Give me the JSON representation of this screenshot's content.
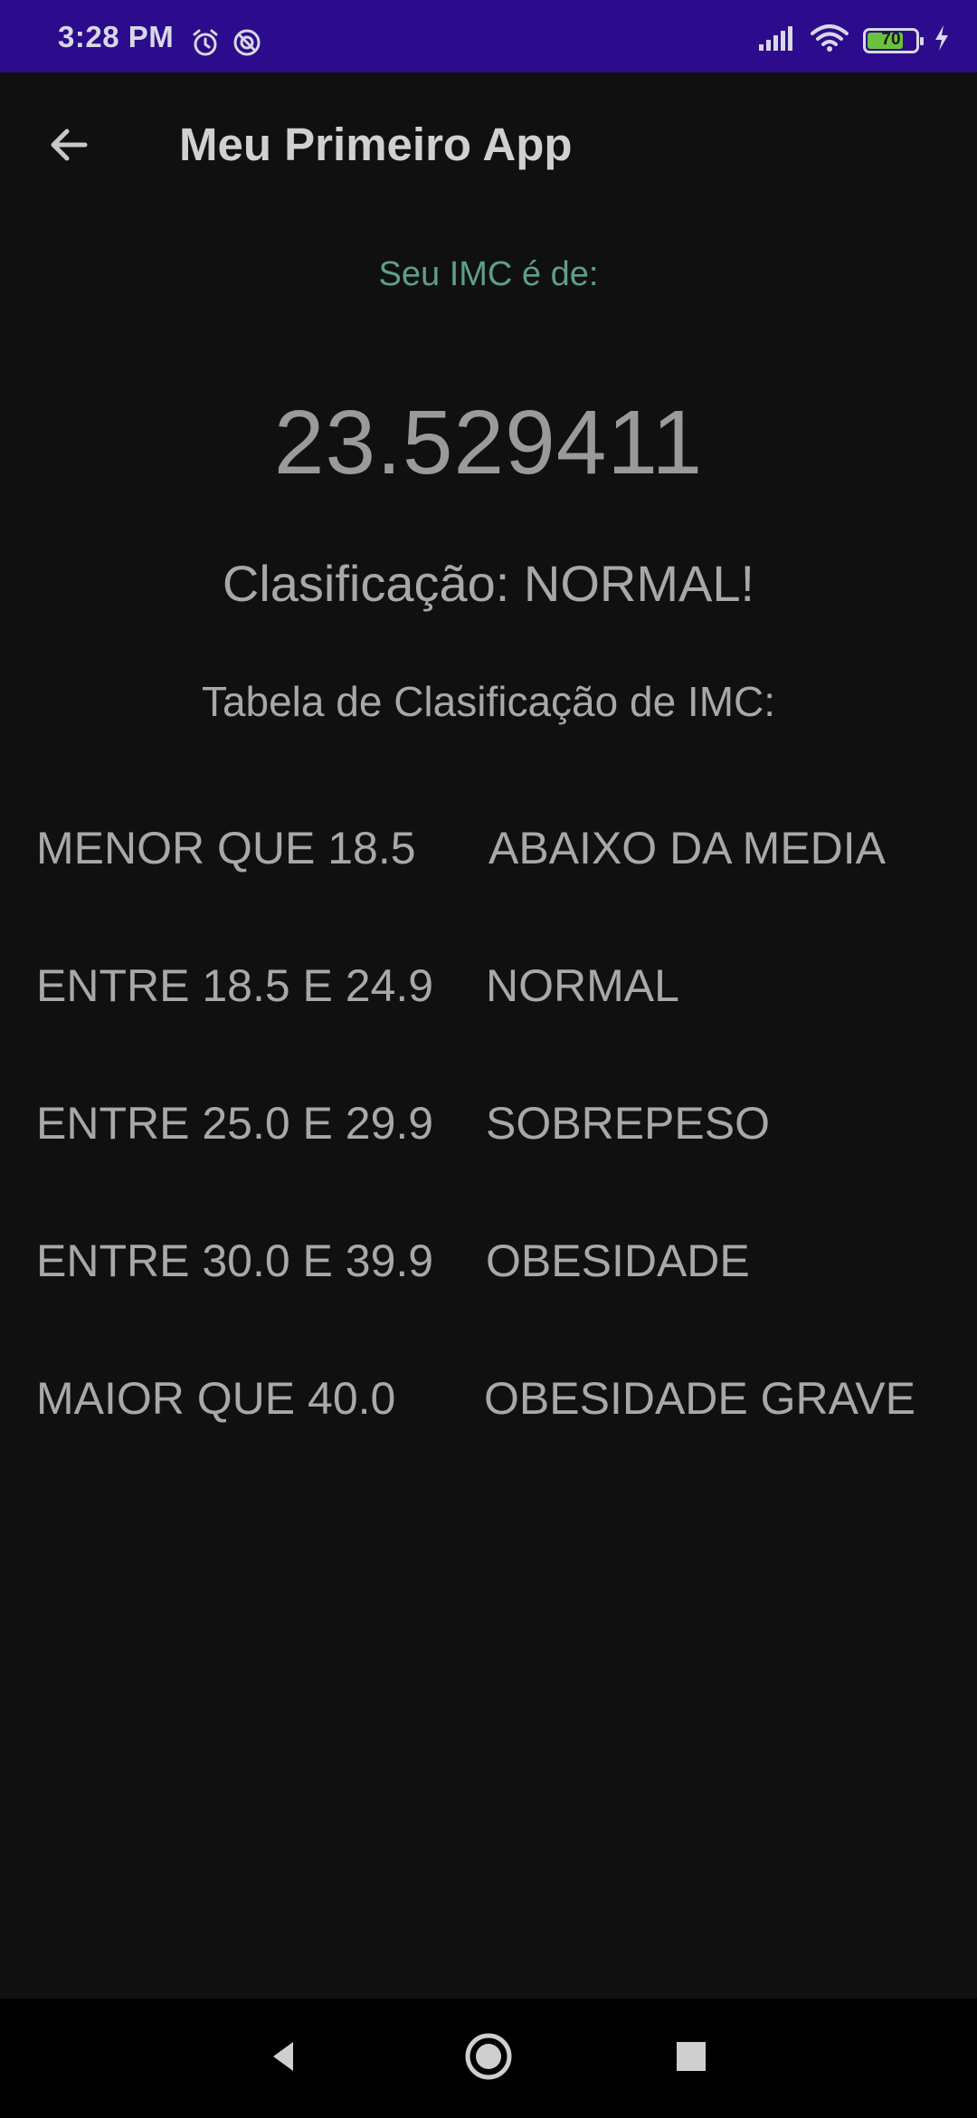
{
  "status_bar": {
    "time": "3:28 PM",
    "battery_level": "70",
    "icons": [
      "alarm-icon",
      "do-not-disturb-icon",
      "signal-icon",
      "wifi-icon",
      "battery-icon",
      "charging-icon"
    ]
  },
  "app_bar": {
    "title": "Meu Primeiro App",
    "back_icon": "arrow-left-icon"
  },
  "result": {
    "label": "Seu IMC é de:",
    "value": "23.529411",
    "classification": "Clasificação: NORMAL!"
  },
  "table": {
    "title": "Tabela de Clasificação de IMC:",
    "rows": [
      {
        "range": "MENOR QUE 18.5",
        "label": "ABAIXO DA MEDIA"
      },
      {
        "range": "ENTRE 18.5 E 24.9",
        "label": "NORMAL"
      },
      {
        "range": "ENTRE 25.0 E 29.9",
        "label": "SOBREPESO"
      },
      {
        "range": "ENTRE 30.0 E 39.9",
        "label": "OBESIDADE"
      },
      {
        "range": "MAIOR QUE 40.0",
        "label": "OBESIDADE GRAVE"
      }
    ]
  },
  "nav_bar": {
    "icons": [
      "back-triangle-icon",
      "home-circle-icon",
      "recents-square-icon"
    ]
  },
  "colors": {
    "status_bar": "#2c0c8c",
    "background": "#101010",
    "accent_label": "#5f9e8c",
    "text": "#a8a8a8"
  }
}
